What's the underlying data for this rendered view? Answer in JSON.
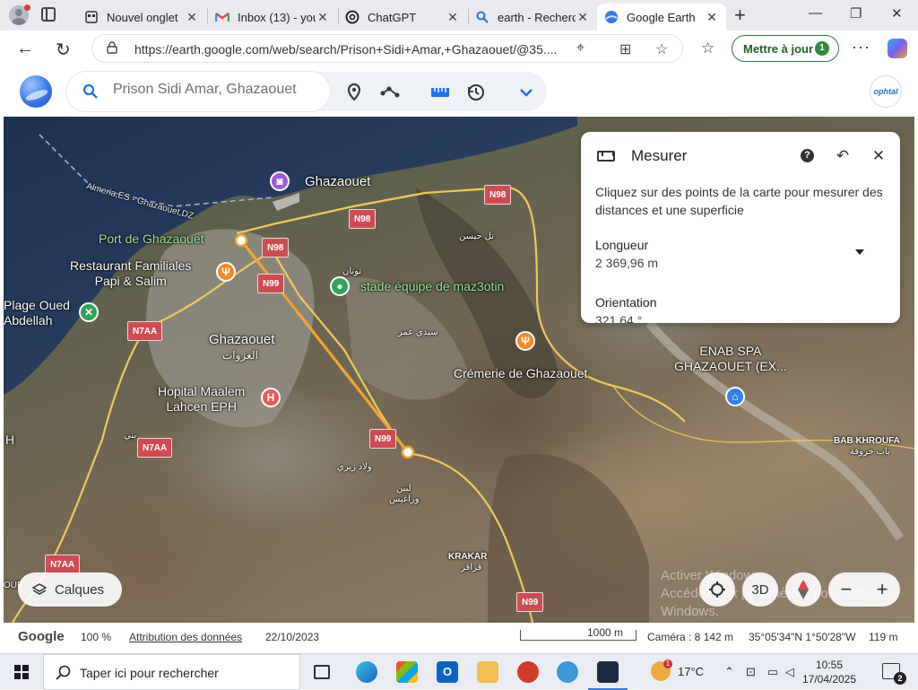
{
  "browser": {
    "tabs": [
      {
        "label": "Nouvel onglet",
        "favicon": "new-tab-icon"
      },
      {
        "label": "Inbox (13) - you",
        "favicon": "gmail-icon"
      },
      {
        "label": "ChatGPT",
        "favicon": "chatgpt-icon"
      },
      {
        "label": "earth - Recherch",
        "favicon": "search-icon"
      },
      {
        "label": "Google Earth",
        "favicon": "google-earth-icon",
        "active": true
      }
    ],
    "url": "https://earth.google.com/web/search/Prison+Sidi+Amar,+Ghazaouet/@35....",
    "update_button": "Mettre à jour",
    "update_badge": "1"
  },
  "earth": {
    "search_placeholder": "Prison Sidi Amar, Ghazaouet",
    "right_logo": "ophtal",
    "measure": {
      "title": "Mesurer",
      "description": "Cliquez sur des points de la carte pour mesurer des distances et une superficie",
      "length_label": "Longueur",
      "length_value": "2 369,96 m",
      "orientation_label": "Orientation",
      "orientation_value": "321,64 °"
    },
    "map_labels": {
      "route_label": "Almeria,ES - Ghazaouet,DZ",
      "ghazaouet_top": "Ghazaouet",
      "port": "Port de Ghazaouet",
      "restaurant": "Restaurant Familiales\nPapi & Salim",
      "plage": "Plage Oued\nAbdellah",
      "stade": "stade équipe de maz3otin",
      "ghazaouet_city": "Ghazaouet",
      "ghazaouet_arabic": "الغزوات",
      "hopital": "Hopital Maalem\nLahcen EPH",
      "cremerie": "Crémerie de Ghazaouet",
      "enab": "ENAB SPA\nGHAZAOUET (EX...",
      "bab": "BAB KHROUFA",
      "bab_arabic": "باب خروفة",
      "krakar": "KRAKAR",
      "krakar_arabic": "قراقر",
      "ar_1": "بني",
      "ar_2": "ولاد زيري",
      "ar_3": "لبين",
      "ar_4": "وراغيس",
      "ar_5": "سيدي عمر",
      "ar_6": "تل حيسن",
      "ar_7": "تونان",
      "left_edge": "H",
      "left_edge2": "OUB"
    },
    "roads": {
      "n98_a": "N98",
      "n98_b": "N98",
      "n98_c": "N98",
      "n99_a": "N99",
      "n99_b": "N99",
      "n99_c": "N99",
      "n7aa_a": "N7AA",
      "n7aa_b": "N7AA",
      "n7aa_c": "N7AA"
    },
    "controls": {
      "layers": "Calques",
      "mode_3d": "3D",
      "zoom_out": "−",
      "zoom_in": "+",
      "watermark": "Activer Windows\nAccédez aux paramètres pour activer\nWindows."
    },
    "status": {
      "brand": "Google",
      "zoom": "100 %",
      "attribution": "Attribution des données",
      "date": "22/10/2023",
      "scale": "1000 m",
      "camera": "Caméra : 8 142 m",
      "coords": "35°05'34\"N 1°50'28\"W",
      "altitude": "119 m"
    }
  },
  "taskbar": {
    "search_placeholder": "Taper ici pour rechercher",
    "weather": "17°C",
    "weather_badge": "1",
    "time": "10:55",
    "date": "17/04/2025",
    "notifications": "2"
  },
  "colors": {
    "measure_line": "#f2a431",
    "road_shield": "#cf4b52",
    "update_green": "#2b7a3b",
    "poi_orange": "#f28a26",
    "poi_purple": "#9b5bd6",
    "poi_green": "#2fa45a",
    "poi_red": "#e45b5b",
    "poi_blue": "#2f82e6"
  }
}
